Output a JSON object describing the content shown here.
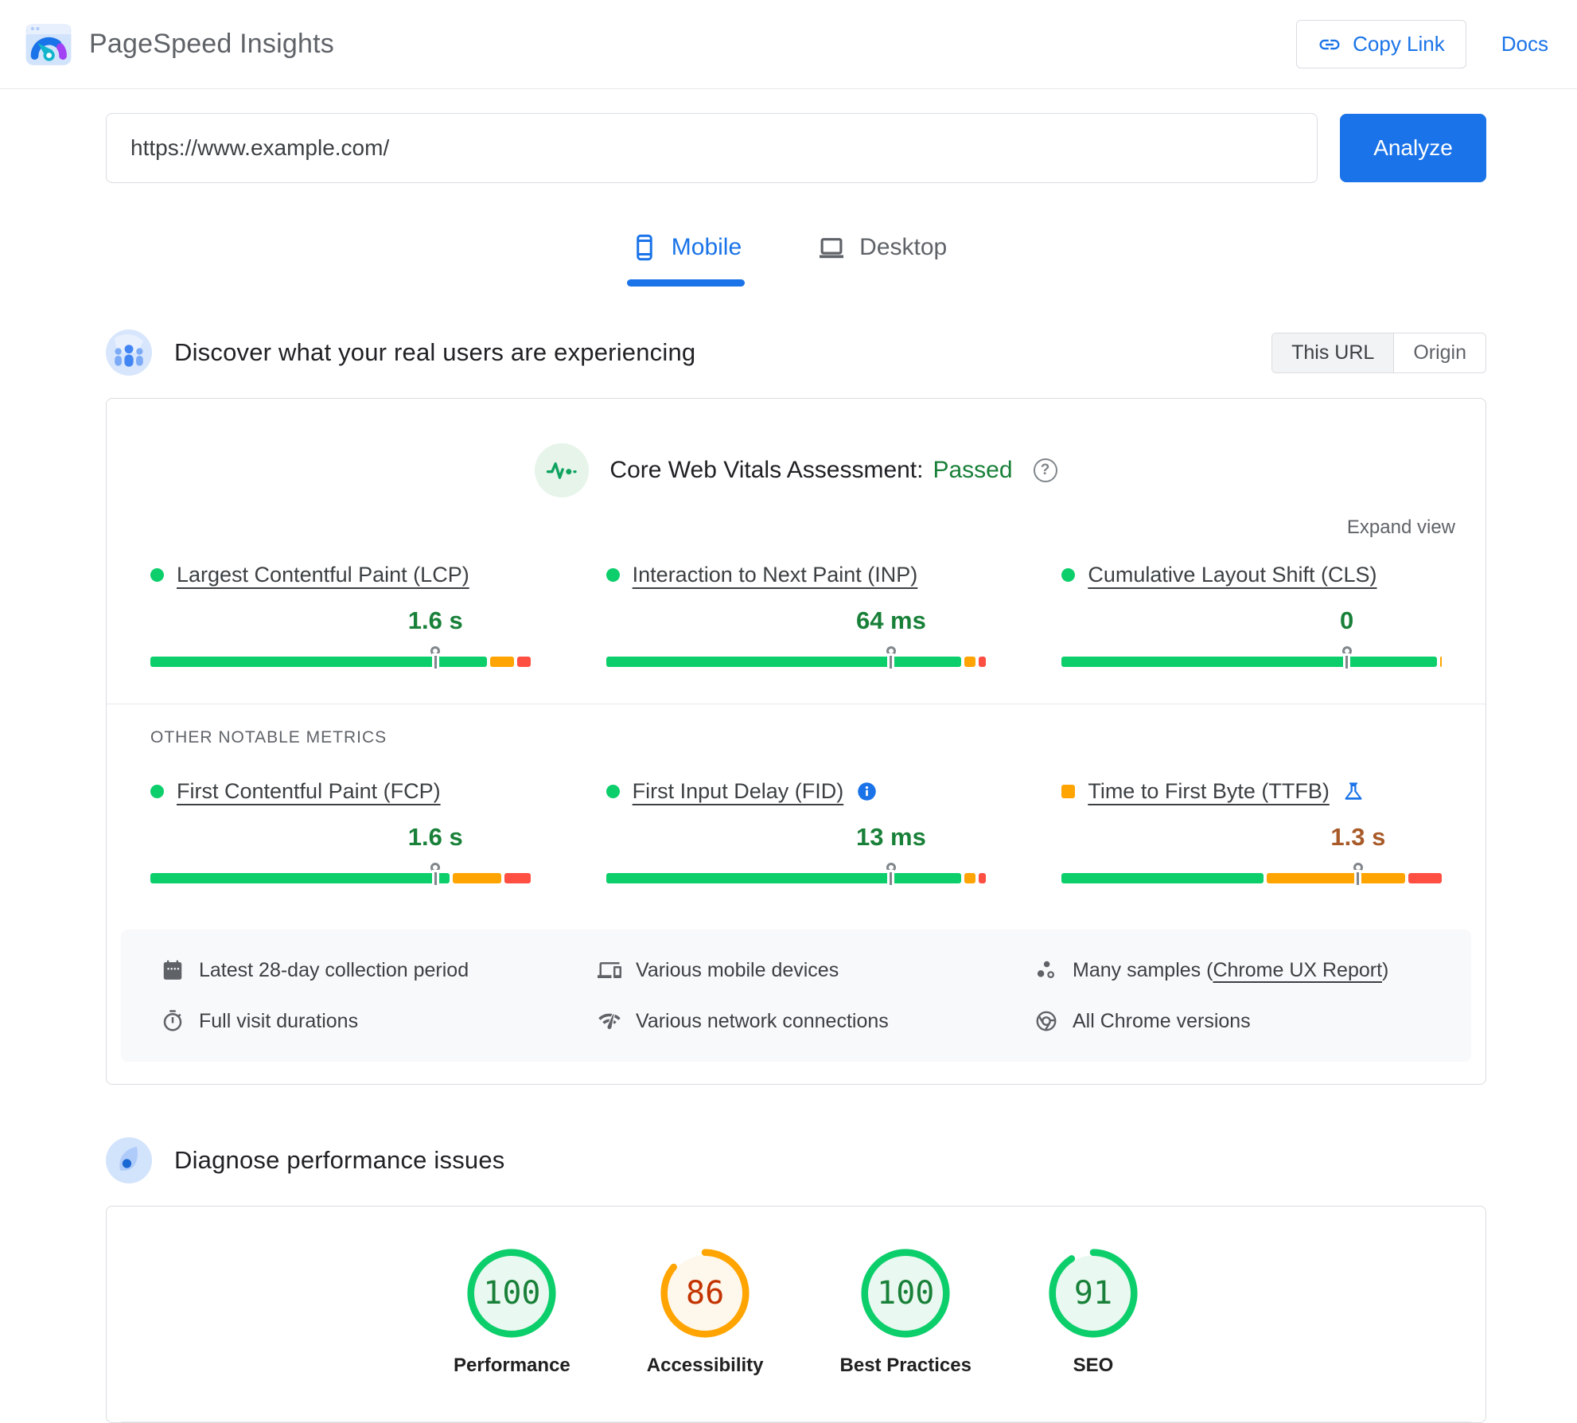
{
  "header": {
    "title": "PageSpeed Insights",
    "copy_link_label": "Copy Link",
    "docs_label": "Docs"
  },
  "url_form": {
    "url": "https://www.example.com/",
    "analyze_label": "Analyze"
  },
  "tabs": {
    "mobile": "Mobile",
    "desktop": "Desktop"
  },
  "crux": {
    "section_title": "Discover what your real users are experiencing",
    "toggle": {
      "this_url": "This URL",
      "origin": "Origin"
    },
    "assessment_label": "Core Web Vitals Assessment:",
    "assessment_result": "Passed",
    "expand_view": "Expand view",
    "core_metrics": [
      {
        "name": "Largest Contentful Paint (LCP)",
        "value": "1.6 s",
        "status": "good",
        "marker_pct": 75,
        "segments": {
          "good": 90,
          "needs_improvement": 6.5,
          "poor": 3.5
        }
      },
      {
        "name": "Interaction to Next Paint (INP)",
        "value": "64 ms",
        "status": "good",
        "marker_pct": 75,
        "segments": {
          "good": 95,
          "needs_improvement": 3,
          "poor": 2
        }
      },
      {
        "name": "Cumulative Layout Shift (CLS)",
        "value": "0",
        "status": "good",
        "marker_pct": 75,
        "segments": {
          "good": 99.5,
          "needs_improvement": 0.5,
          "poor": 0
        }
      }
    ],
    "other_metrics_label": "OTHER NOTABLE METRICS",
    "other_metrics": [
      {
        "name": "First Contentful Paint (FCP)",
        "value": "1.6 s",
        "status": "good",
        "marker_pct": 75,
        "segments": {
          "good": 80,
          "needs_improvement": 13,
          "poor": 7
        }
      },
      {
        "name": "First Input Delay (FID)",
        "value": "13 ms",
        "status": "good",
        "marker_pct": 75,
        "segments": {
          "good": 95,
          "needs_improvement": 3,
          "poor": 2
        }
      },
      {
        "name": "Time to First Byte (TTFB)",
        "value": "1.3 s",
        "status": "needs-improvement",
        "marker_pct": 78,
        "segments": {
          "good": 54,
          "needs_improvement": 37,
          "poor": 9
        }
      }
    ],
    "collection_info": [
      {
        "icon": "calendar",
        "text": "Latest 28-day collection period"
      },
      {
        "icon": "devices",
        "text": "Various mobile devices"
      },
      {
        "icon": "samples",
        "text_prefix": "Many samples (",
        "link_text": "Chrome UX Report",
        "text_suffix": ")"
      },
      {
        "icon": "stopwatch",
        "text": "Full visit durations"
      },
      {
        "icon": "network",
        "text": "Various network connections"
      },
      {
        "icon": "chrome",
        "text": "All Chrome versions"
      }
    ]
  },
  "diagnose": {
    "section_title": "Diagnose performance issues",
    "scores": [
      {
        "value": "100",
        "pct": 100,
        "status": "good",
        "label": "Performance"
      },
      {
        "value": "86",
        "pct": 86,
        "status": "average",
        "label": "Accessibility"
      },
      {
        "value": "100",
        "pct": 100,
        "status": "good",
        "label": "Best Practices"
      },
      {
        "value": "91",
        "pct": 91,
        "status": "good",
        "label": "SEO"
      }
    ]
  },
  "colors": {
    "accent_blue": "#1a73e8",
    "good_green": "#0cce6b",
    "needs_improvement_orange": "#ffa400",
    "poor_red": "#ff4e42",
    "passed_green": "#188038"
  }
}
